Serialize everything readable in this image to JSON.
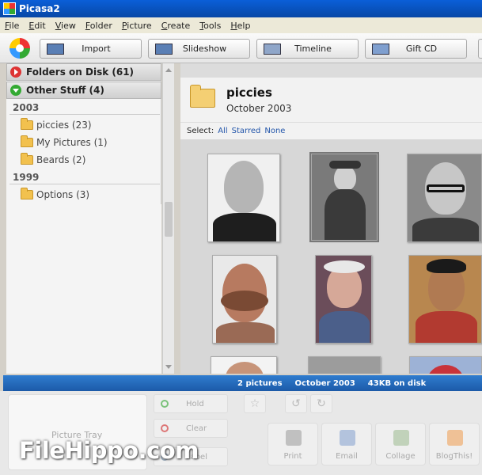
{
  "window": {
    "title": "Picasa2"
  },
  "menu": [
    "File",
    "Edit",
    "View",
    "Folder",
    "Picture",
    "Create",
    "Tools",
    "Help"
  ],
  "toolbar": {
    "import": "Import",
    "slideshow": "Slideshow",
    "timeline": "Timeline",
    "giftcd": "Gift CD"
  },
  "sidebar": {
    "folders_on_disk": "Folders on Disk (61)",
    "other_stuff": "Other Stuff (4)",
    "years": [
      {
        "year": "2003",
        "items": [
          "piccies (23)",
          "My Pictures (1)",
          "Beards (2)"
        ]
      },
      {
        "year": "1999",
        "items": [
          "Options (3)"
        ]
      }
    ]
  },
  "folder": {
    "title": "piccies",
    "date": "October 2003"
  },
  "select": {
    "label": "Select:",
    "all": "All",
    "starred": "Starred",
    "none": "None"
  },
  "status": {
    "count": "2 pictures",
    "date": "October 2003",
    "size": "43KB on disk"
  },
  "tray": {
    "label": "Picture Tray",
    "hold": "Hold",
    "clear": "Clear",
    "label_btn": "Label"
  },
  "actions": [
    "Print",
    "Email",
    "Collage",
    "BlogThis!"
  ],
  "watermark": "FileHippo.com"
}
